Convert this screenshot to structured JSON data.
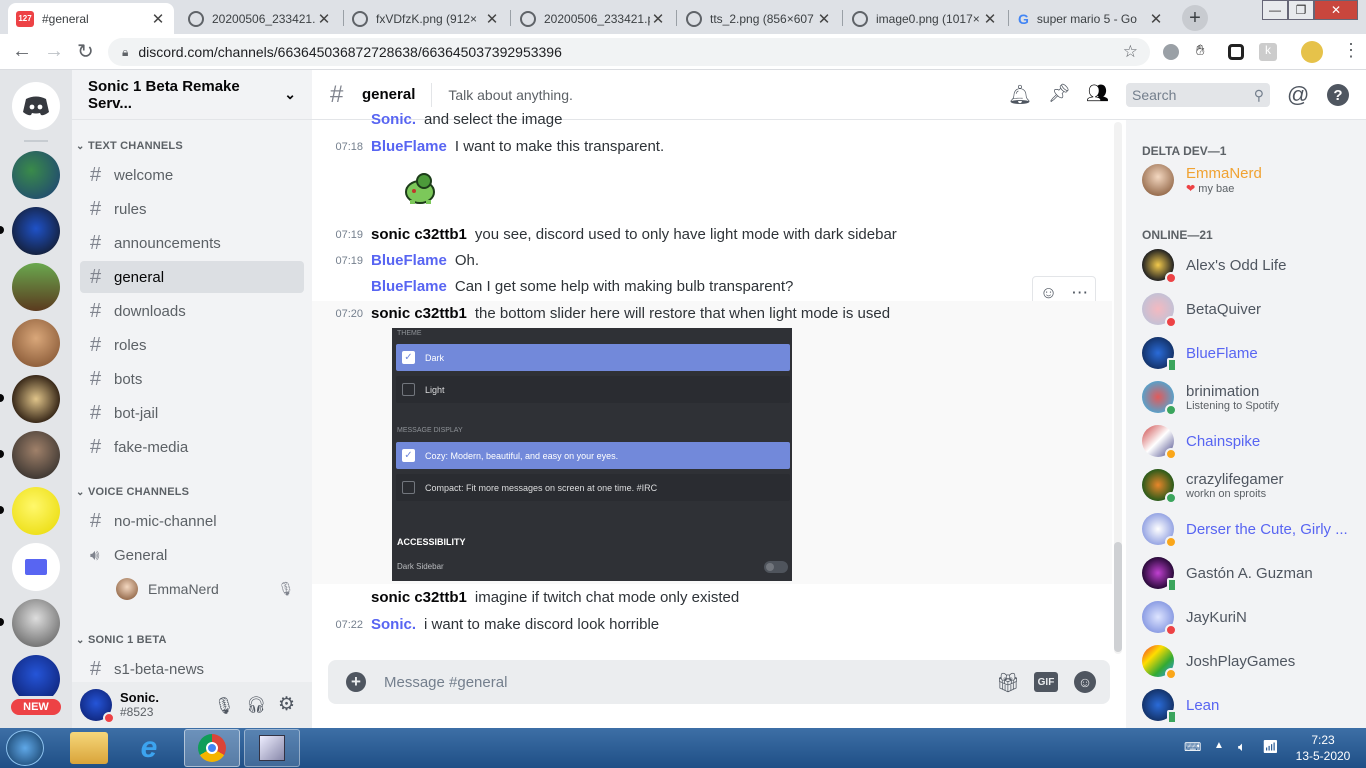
{
  "browser": {
    "tabs": [
      {
        "title": "#general",
        "badge": "127",
        "active": true
      },
      {
        "title": "20200506_233421.p",
        "active": false
      },
      {
        "title": "fxVDfzK.png (912×",
        "active": false
      },
      {
        "title": "20200506_233421.p",
        "active": false
      },
      {
        "title": "tts_2.png (856×607",
        "active": false
      },
      {
        "title": "image0.png (1017×",
        "active": false
      },
      {
        "title": "super mario 5 - Go",
        "active": false
      }
    ],
    "url": "discord.com/channels/663645036872728638/663645037392953396"
  },
  "server": {
    "name": "Sonic 1 Beta Remake Serv...",
    "new_badge": "NEW",
    "categories": {
      "text": "TEXT CHANNELS",
      "voice": "VOICE CHANNELS",
      "beta": "SONIC 1 BETA"
    },
    "text_channels": [
      "welcome",
      "rules",
      "announcements",
      "general",
      "downloads",
      "roles",
      "bots",
      "bot-jail",
      "fake-media"
    ],
    "voice_channels": [
      "no-mic-channel"
    ],
    "voice_room": "General",
    "voice_user": "EmmaNerd",
    "beta_channels": [
      "s1-beta-news"
    ]
  },
  "user": {
    "name": "Sonic.",
    "tag": "#8523"
  },
  "chat": {
    "channel": "general",
    "topic": "Talk about anything.",
    "search_placeholder": "Search",
    "composer_placeholder": "Message #general",
    "gif_label": "GIF",
    "messages": [
      {
        "time": "",
        "author": "Sonic.",
        "text": "and select the image"
      },
      {
        "time": "07:18",
        "author": "BlueFlame",
        "text": "I want to make this transparent."
      },
      {
        "time": "07:19",
        "author": "sonic c32ttb1",
        "text": "you see, discord used to only have light mode with dark sidebar"
      },
      {
        "time": "07:19",
        "author": "BlueFlame",
        "text": "Oh."
      },
      {
        "time": "",
        "author": "BlueFlame",
        "text": "Can I get some help with making bulb transparent?"
      },
      {
        "time": "07:20",
        "author": "sonic c32ttb1",
        "text": "the bottom slider here will restore that when light mode is used"
      },
      {
        "time": "",
        "author": "sonic c32ttb1",
        "text": "imagine if twitch chat mode only existed"
      },
      {
        "time": "07:22",
        "author": "Sonic.",
        "text": "i want to make discord look horrible"
      }
    ],
    "settings_image": {
      "theme_label": "THEME",
      "dark": "Dark",
      "light": "Light",
      "display_label": "MESSAGE DISPLAY",
      "cozy": "Cozy: Modern, beautiful, and easy on your eyes.",
      "compact": "Compact: Fit more messages on screen at one time. #IRC",
      "accessibility": "ACCESSIBILITY",
      "dark_sidebar": "Dark Sidebar"
    }
  },
  "members": {
    "sections": [
      {
        "title": "DELTA DEV—1",
        "members": [
          {
            "name": "EmmaNerd",
            "sub": "my bae",
            "color": "#f0a232",
            "status": "none"
          }
        ]
      },
      {
        "title": "ONLINE—21",
        "members": [
          {
            "name": "Alex's Odd Life",
            "sub": "",
            "color": "#4f5660",
            "status": "dnd"
          },
          {
            "name": "BetaQuiver",
            "sub": "",
            "color": "#4f5660",
            "status": "dnd"
          },
          {
            "name": "BlueFlame",
            "sub": "",
            "color": "#5865f2",
            "status": "mob"
          },
          {
            "name": "brinimation",
            "sub": "Listening to Spotify",
            "color": "#4f5660",
            "status": "on"
          },
          {
            "name": "Chainspike",
            "sub": "",
            "color": "#5865f2",
            "status": "idle"
          },
          {
            "name": "crazylifegamer",
            "sub": "workn on sproits",
            "color": "#4f5660",
            "status": "on"
          },
          {
            "name": "Derser the Cute, Girly ...",
            "sub": "",
            "color": "#5865f2",
            "status": "idle"
          },
          {
            "name": "Gastón A. Guzman",
            "sub": "",
            "color": "#4f5660",
            "status": "mob"
          },
          {
            "name": "JayKuriN",
            "sub": "",
            "color": "#4f5660",
            "status": "dnd"
          },
          {
            "name": "JoshPlayGames",
            "sub": "",
            "color": "#4f5660",
            "status": "idle"
          },
          {
            "name": "Lean",
            "sub": "",
            "color": "#5865f2",
            "status": "mob"
          }
        ]
      }
    ]
  },
  "taskbar": {
    "time": "7:23",
    "date": "13-5-2020"
  },
  "colors": {
    "accent": "#5865f2",
    "dnd": "#ed4245",
    "online": "#3ba55d",
    "idle": "#faa61a"
  }
}
